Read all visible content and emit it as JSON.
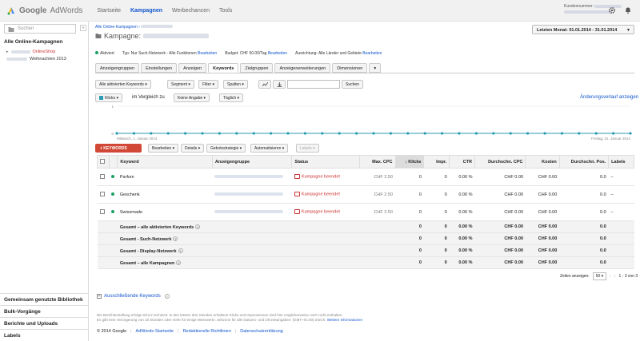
{
  "app": {
    "brand_google": "Google",
    "brand_product": "AdWords"
  },
  "nav": [
    "Startseite",
    "Kampagnen",
    "Werbechancen",
    "Tools"
  ],
  "account": {
    "label": "Kundennummer:"
  },
  "sidebar": {
    "search_placeholder": "Suchen",
    "collapse": "«",
    "all_campaigns": "Alle Online-Kampagnen",
    "shop": "OnlineShop",
    "campaign": "Weihnachten 2013",
    "bottom": [
      "Gemeinsam genutzte Bibliothek",
      "Bulk-Vorgänge",
      "Berichte und Uploads",
      "Labels"
    ]
  },
  "breadcrumb": "Alle Online-Kampagnen",
  "campaign_title": "Kampagne:",
  "date_range": "Letzten Monat: 01.01.2014 - 31.01.2014",
  "meta": {
    "status": "Aktiviert",
    "type": "Typ: Nur Such-Netzwerk - Alle Funktionen",
    "type_edit": "Bearbeiten",
    "budget": "Budget: CHF 50.00/Tag",
    "budget_edit": "Bearbeiten",
    "targeting": "Ausrichtung: Alle Länder und Gebiete",
    "targeting_edit": "Bearbeiten"
  },
  "tabs": [
    "Anzeigengruppen",
    "Einstellungen",
    "Anzeigen",
    "Keywords",
    "Zielgruppen",
    "Anzeigenerweiterungen",
    "Dimensionen",
    "▾"
  ],
  "toolbar1": {
    "filter_all": "Alle aktivierten Keywords ▾",
    "segment": "Segment ▾",
    "filter": "Filter ▾",
    "columns": "Spalten ▾",
    "search": "Suchen"
  },
  "toolbar2": {
    "metric": "Klicks ▾",
    "compare": "im Vergleich zu",
    "none": "Keine Angabe ▾",
    "period": "Täglich ▾",
    "history": "Änderungsverlauf anzeigen"
  },
  "chart_data": {
    "type": "line",
    "series": [
      {
        "name": "Klicks",
        "values": [
          0,
          0,
          0,
          0,
          0,
          0,
          0,
          0,
          0,
          0,
          0,
          0,
          0,
          0,
          0,
          0,
          0,
          0,
          0,
          0,
          0,
          0,
          0,
          0,
          0,
          0,
          0,
          0,
          0,
          0,
          0
        ]
      }
    ],
    "ylim": [
      0,
      1
    ],
    "start_label": "Mittwoch, 1. Januar 2014",
    "end_label": "Freitag, 31. Januar 2014"
  },
  "actions": {
    "add": "+ KEYWORDS",
    "edit": "Bearbeiten ▾",
    "details": "Details ▾",
    "bid": "Gebotsstrategie ▾",
    "automate": "Automatisieren ▾",
    "labels": "Labels ▾"
  },
  "table": {
    "headers": [
      "Keyword",
      "Anzeigengruppe",
      "Status",
      "Max. CPC",
      "Klicks",
      "Impr.",
      "CTR",
      "Durchschn. CPC",
      "Kosten",
      "Durchschn. Pos.",
      "Labels"
    ],
    "rows": [
      {
        "keyword": "Parfum",
        "status": "Kampagne beendet",
        "cpc": "CHF 2.50",
        "clicks": "0",
        "impr": "0",
        "ctr": "0.00 %",
        "avg_cpc": "CHF 0.00",
        "cost": "CHF 0.00",
        "pos": "0.0",
        "labels": "–"
      },
      {
        "keyword": "Geschenk",
        "status": "Kampagne beendet",
        "cpc": "CHF 2.50",
        "clicks": "0",
        "impr": "0",
        "ctr": "0.00 %",
        "avg_cpc": "CHF 0.00",
        "cost": "CHF 0.00",
        "pos": "0.0",
        "labels": "–"
      },
      {
        "keyword": "Swissmade",
        "status": "Kampagne beendet",
        "cpc": "CHF 2.50",
        "clicks": "0",
        "impr": "0",
        "ctr": "0.00 %",
        "avg_cpc": "CHF 0.00",
        "cost": "CHF 0.00",
        "pos": "0.0",
        "labels": "–"
      }
    ],
    "totals": [
      {
        "label": "Gesamt – alle aktivierten Keywords",
        "clicks": "0",
        "impr": "0",
        "ctr": "0.00 %",
        "avg_cpc": "CHF 0.00",
        "cost": "CHF 0.00",
        "pos": "0.0"
      },
      {
        "label": "Gesamt - Such-Netzwerk",
        "clicks": "0",
        "impr": "0",
        "ctr": "0.00 %",
        "avg_cpc": "CHF 0.00",
        "cost": "CHF 0.00",
        "pos": "0.0"
      },
      {
        "label": "Gesamt - Display-Netzwerk",
        "clicks": "0",
        "impr": "0",
        "ctr": "0.00 %",
        "avg_cpc": "CHF 0.00",
        "cost": "CHF 0.00",
        "pos": "0.0"
      },
      {
        "label": "Gesamt – alle Kampagnen",
        "clicks": "0",
        "impr": "0",
        "ctr": "0.00 %",
        "avg_cpc": "CHF 0.00",
        "cost": "CHF 0.00",
        "pos": "0.0"
      }
    ]
  },
  "pager": {
    "label": "Zeilen anzeigen:",
    "size": "50",
    "range": "1 - 3 von 3"
  },
  "negative": "Ausschließende Keywords",
  "note": {
    "line1": "Die Berichterstellung erfolgt nicht in Echtzeit. In den letzten drei Stunden erhaltene Klicks und Impressionen sind hier möglicherweise noch nicht enthalten.",
    "line2": "Es gibt eine Verzögerung von 18 Stunden oder mehr für einige Messwerte. Zeitzone für alle Datums- und Uhrzeitangaben: (GMT+01:00) Zürich.",
    "more": "Weitere Informationen"
  },
  "footer": {
    "copy": "© 2014 Google",
    "links": [
      "AdWords-Startseite",
      "Redaktionelle Richtlinien",
      "Datenschutzerklärung"
    ]
  },
  "colors": {
    "accent": "#15c",
    "red": "#d14836",
    "chart": "#2a9bb2",
    "green": "#1aa260"
  }
}
